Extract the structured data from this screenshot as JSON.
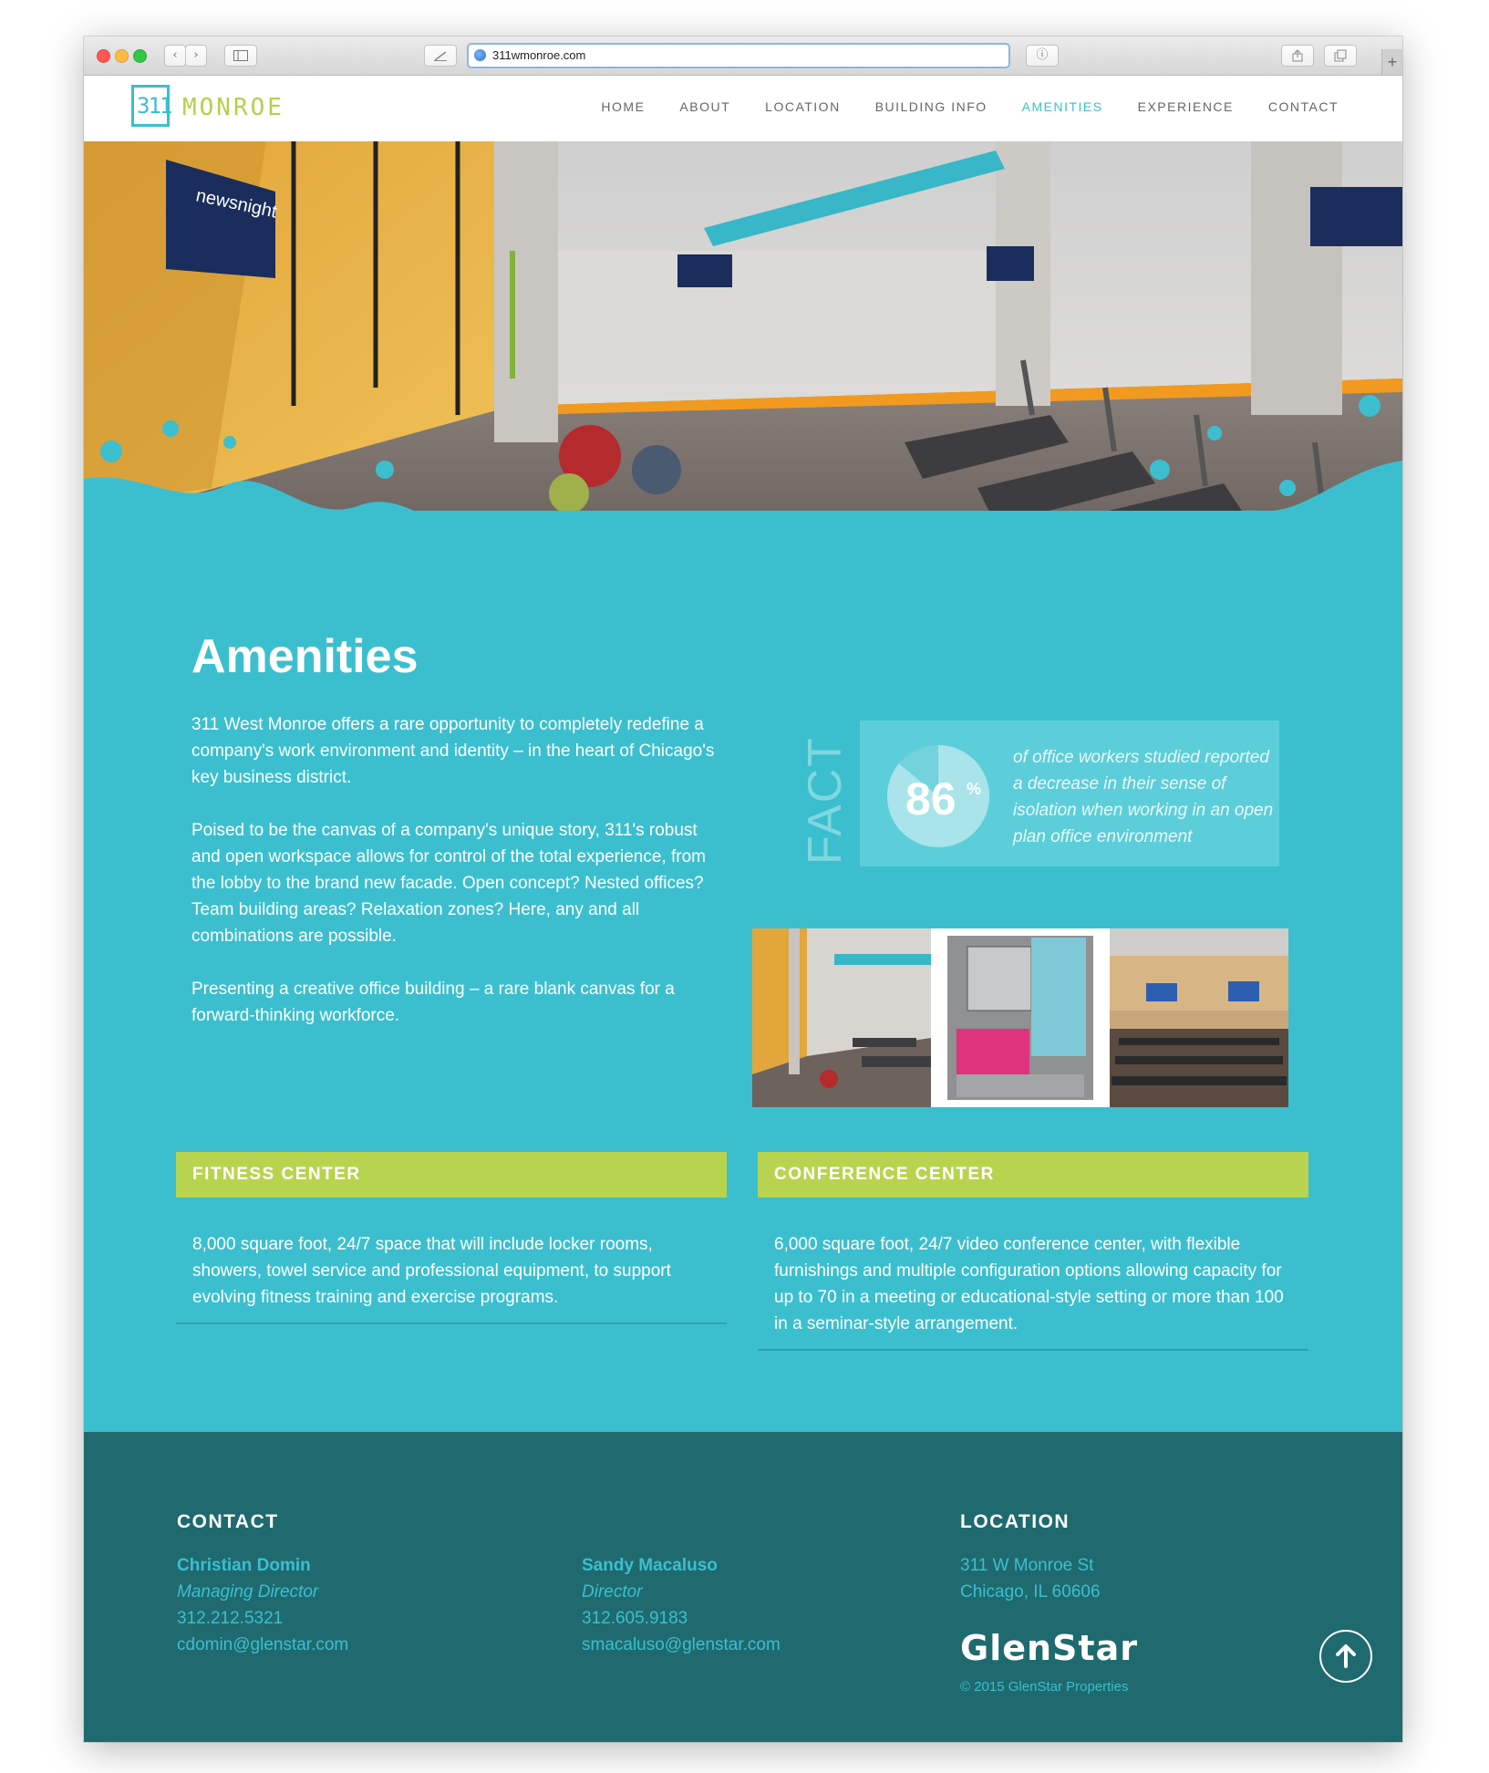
{
  "browser": {
    "url": "311wmonroe.com"
  },
  "site": {
    "logo_number": "311",
    "logo_name": "MONROE",
    "nav": [
      {
        "label": "HOME"
      },
      {
        "label": "ABOUT"
      },
      {
        "label": "LOCATION"
      },
      {
        "label": "BUILDING INFO"
      },
      {
        "label": "AMENITIES",
        "active": true
      },
      {
        "label": "EXPERIENCE"
      },
      {
        "label": "CONTACT"
      }
    ]
  },
  "hero": {
    "tv_brand": "newsnight"
  },
  "main": {
    "title": "Amenities",
    "paragraphs": [
      "311 West Monroe offers a rare opportunity to completely redefine a company's work environment and identity – in the heart of Chicago's key business district.",
      "Poised to be the canvas of a company's unique story, 311's robust and open workspace allows for control of the total experience, from the lobby to the brand new facade. Open concept? Nested offices? Team building areas? Relaxation zones? Here, any and all combinations are possible.",
      "Presenting a creative office building – a rare blank canvas for a forward-thinking workforce."
    ],
    "fact": {
      "label": "FACT",
      "value": "86",
      "percent_sign": "%",
      "percent_value": 86,
      "text": "of office workers studied reported a decrease in their sense of isolation when working in an open plan office environment"
    },
    "panels": [
      {
        "title": "FITNESS CENTER",
        "body": "8,000 square foot, 24/7 space that will include locker rooms, showers, towel service and professional equipment, to support evolving fitness training and exercise programs."
      },
      {
        "title": "CONFERENCE CENTER",
        "body": "6,000 square foot, 24/7 video conference center, with flexible furnishings and multiple configuration options allowing capacity for up to 70 in a meeting or educational-style setting or more than 100 in a seminar-style arrangement."
      }
    ]
  },
  "footer": {
    "contact_heading": "CONTACT",
    "contacts": [
      {
        "name": "Christian Domin",
        "role": "Managing Director",
        "phone": "312.212.5321",
        "email": "cdomin@glenstar.com"
      },
      {
        "name": "Sandy Macaluso",
        "role": "Director",
        "phone": "312.605.9183",
        "email": "smacaluso@glenstar.com"
      }
    ],
    "location_heading": "LOCATION",
    "address_line1": "311 W Monroe St",
    "address_line2": "Chicago, IL 60606",
    "brand": "GlenStar",
    "copyright": "© 2015 GlenStar Properties"
  },
  "colors": {
    "teal": "#3bbfcf",
    "lime": "#b8d44e",
    "footer_teal": "#1f6a6f"
  }
}
